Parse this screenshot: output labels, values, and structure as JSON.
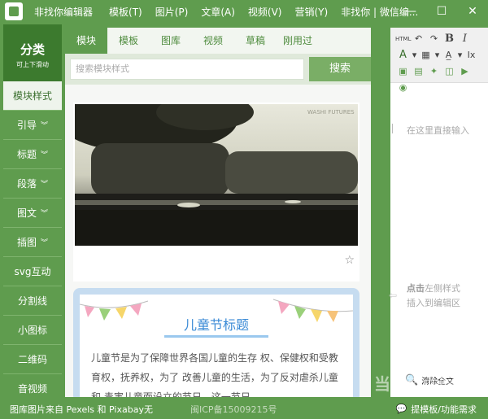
{
  "titlebar": {
    "menu": [
      "非找你编辑器",
      "模板(T)",
      "图片(P)",
      "文章(A)",
      "视频(V)",
      "营销(Y)",
      "非找你 | 微信编..."
    ],
    "minimize": "—",
    "maximize": "☐",
    "close": "✕"
  },
  "sidebar": {
    "header_title": "分类",
    "header_subtitle": "可上下滑动",
    "items": [
      {
        "label": "模块样式"
      },
      {
        "label": "引导"
      },
      {
        "label": "标题"
      },
      {
        "label": "段落"
      },
      {
        "label": "图文"
      },
      {
        "label": "插图"
      },
      {
        "label": "svg互动"
      },
      {
        "label": "分割线"
      },
      {
        "label": "小图标"
      },
      {
        "label": "二维码"
      },
      {
        "label": "音视频"
      }
    ],
    "chevron": "❯"
  },
  "main": {
    "tabs": [
      "模块",
      "模板",
      "图库",
      "视频",
      "草稿",
      "刚用过"
    ],
    "search_placeholder": "搜索模块样式",
    "search_button": "搜索",
    "photo_watermark": "WASHI FUTURES",
    "star": "☆",
    "kids_title": "儿童节标题",
    "kids_text": "儿童节是为了保障世界各国儿童的生存 权、保健权和受教育权，抚养权，为了 改善儿童的生活，为了反对虐杀儿童和 毒害儿童而设立的节日。这一节日"
  },
  "editor": {
    "toolbar": [
      "HTML",
      "↶",
      "↷",
      "B",
      "I",
      "A",
      "▾",
      "▦",
      "▾",
      "A̲",
      "▾",
      "Ix",
      "▣",
      "▤",
      "✦",
      "◫",
      "▶",
      "◉"
    ],
    "placeholder": "在这里直接输入",
    "hint_bold": "点击",
    "hint_line1": "左侧样式",
    "hint_line2": "插入到编辑区",
    "clear_label": "清除全文",
    "arrow": "⇦"
  },
  "watermark": "当下软件园",
  "statusbar": {
    "left": "图库图片来自 Pexels 和 Pixabay无",
    "icp": "闽ICP备15009215号",
    "right": "提模板/功能需求"
  },
  "colors": {
    "brand_green": "#5f9c4e",
    "dark_green": "#3c7a2e",
    "kids_blue": "#3a8ad6"
  }
}
